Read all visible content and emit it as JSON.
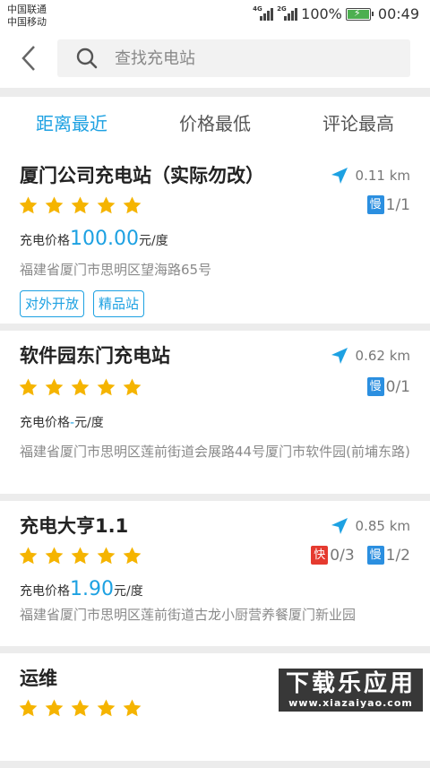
{
  "status": {
    "carrier1": "中国联通",
    "carrier2": "中国移动",
    "net1": "4G",
    "net2": "2G",
    "battery": "100%",
    "time": "00:49"
  },
  "search": {
    "placeholder": "查找充电站"
  },
  "tabs": [
    {
      "label": "距离最近",
      "active": true
    },
    {
      "label": "价格最低",
      "active": false
    },
    {
      "label": "评论最高",
      "active": false
    }
  ],
  "price_label": "充电价格",
  "price_unit": "元/度",
  "slow_label": "慢",
  "fast_label": "快",
  "stations": [
    {
      "name": "厦门公司充电站（实际勿改）",
      "distance": "0.11 km",
      "rating": 5,
      "slow": "1/1",
      "price": "100.00",
      "address": "福建省厦门市思明区望海路65号",
      "tags": [
        "对外开放",
        "精品站"
      ]
    },
    {
      "name": "软件园东门充电站",
      "distance": "0.62 km",
      "rating": 5,
      "slow": "0/1",
      "price": "-",
      "address": "福建省厦门市思明区莲前街道会展路44号厦门市软件园(前埔东路)"
    },
    {
      "name": "充电大亨1.1",
      "distance": "0.85 km",
      "rating": 5,
      "fast": "0/3",
      "slow": "1/2",
      "price": "1.90",
      "address": "福建省厦门市思明区莲前街道古龙小厨营养餐厦门新业园"
    },
    {
      "name": "运维",
      "rating": 5
    }
  ],
  "watermark": {
    "line1": "下载乐应用",
    "line2": "www.xiazaiyao.com"
  },
  "colors": {
    "accent": "#1da1e2",
    "star": "#f5b400",
    "slow_badge": "#2b8fe0",
    "fast_badge": "#e53a2f"
  }
}
